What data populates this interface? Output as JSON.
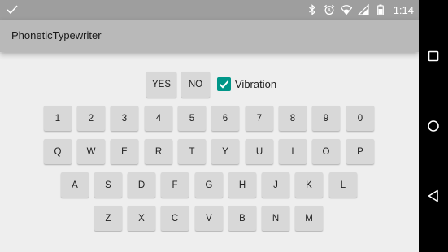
{
  "status_bar": {
    "time": "1:14",
    "icons": [
      "check-icon",
      "bluetooth-icon",
      "alarm-icon",
      "wifi-icon",
      "signal-icon",
      "battery-icon"
    ]
  },
  "app": {
    "title": "PhoneticTypewriter"
  },
  "controls": {
    "yes_label": "YES",
    "no_label": "NO",
    "vibration_label": "Vibration",
    "vibration_checked": true
  },
  "keyboard": {
    "row1": [
      "1",
      "2",
      "3",
      "4",
      "5",
      "6",
      "7",
      "8",
      "9",
      "0"
    ],
    "row2": [
      "Q",
      "W",
      "E",
      "R",
      "T",
      "Y",
      "U",
      "I",
      "O",
      "P"
    ],
    "row3": [
      "A",
      "S",
      "D",
      "F",
      "G",
      "H",
      "J",
      "K",
      "L"
    ],
    "row4": [
      "Z",
      "X",
      "C",
      "V",
      "B",
      "N",
      "M"
    ]
  },
  "nav_bar": {
    "icons": [
      "recents-icon",
      "home-icon",
      "back-icon"
    ]
  },
  "colors": {
    "accent": "#009688",
    "status_bar": "#9e9e9e",
    "app_bar": "#b9b9b9",
    "background": "#eeeeee",
    "key": "#d8d8d8"
  }
}
